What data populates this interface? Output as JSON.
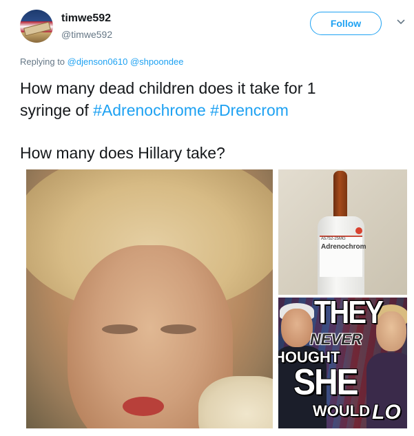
{
  "tweet": {
    "author": {
      "name": "timwe592",
      "handle": "@timwe592",
      "avatar_icon": "flag-wood-plank-avatar"
    },
    "follow_button": "Follow",
    "menu_icon": "chevron-down-icon",
    "replying": {
      "prefix": "Replying to",
      "mentions": [
        "@djenson0610",
        "@shpoondee"
      ]
    },
    "text": {
      "line1": "How many dead children does it take for 1",
      "line2_prefix": "syringe of",
      "hashtags": [
        "#Adrenochrome",
        "#Drencrom"
      ],
      "line3": "How many does Hillary take?"
    },
    "media": {
      "vial_label": {
        "catalog": "A5752-25MG",
        "name": "Adrenochrom"
      },
      "meme_text": [
        "THEY",
        "NEVER",
        "HOUGHT",
        "SHE",
        "WOULD",
        "LO"
      ]
    }
  },
  "colors": {
    "link": "#1da1f2",
    "text": "#14171a",
    "secondary": "#657786"
  }
}
